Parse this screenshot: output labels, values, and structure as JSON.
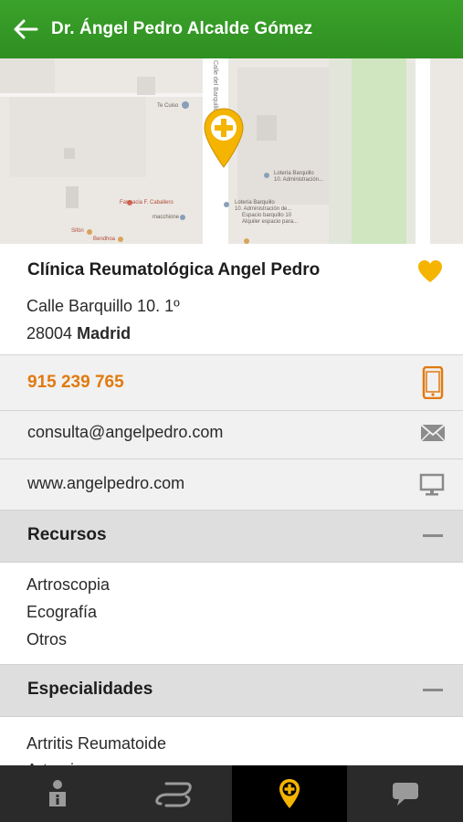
{
  "header": {
    "title": "Dr. Ángel Pedro Alcalde Gómez",
    "back_icon": "arrow-left-icon"
  },
  "map": {
    "labels": {
      "calle": "Calle del Barquillo",
      "te_cuiso": "Te Cuiso",
      "loteria1": "Lotería Barquillo",
      "loteria1b": "10. Administración...",
      "loteria2": "Lotería Barquillo",
      "loteria2b": "10. Administración de...",
      "espacio1": "Espacio barquillo 10",
      "espacio2": "Alquiler espacio para...",
      "farmacia": "Farmacia F. Caballero",
      "macchione": "macchione",
      "sifon": "Sifón",
      "bendhoa": "Bendhoa"
    },
    "pin_icon": "location-pin-plus-icon"
  },
  "clinic": {
    "name": "Clínica Reumatológica Angel Pedro",
    "address_line1": "Calle Barquillo 10. 1º",
    "postal_code": "28004",
    "city": "Madrid",
    "favorite_icon": "heart-icon",
    "favorite_color": "#f4b400"
  },
  "contact": {
    "phone": "915 239 765",
    "phone_icon": "mobile-phone-icon",
    "email": "consulta@angelpedro.com",
    "email_icon": "envelope-icon",
    "website": "www.angelpedro.com",
    "website_icon": "monitor-icon"
  },
  "sections": {
    "recursos": {
      "title": "Recursos",
      "items": [
        "Artroscopia",
        "Ecografía",
        "Otros"
      ],
      "toggle_icon": "minus-icon"
    },
    "especialidades": {
      "title": "Especialidades",
      "items": [
        "Artritis Reumatoide",
        "Artrosis"
      ],
      "toggle_icon": "minus-icon"
    }
  },
  "tabbar": {
    "tabs": [
      {
        "icon": "person-info-icon",
        "active": false
      },
      {
        "icon": "route-icon",
        "active": false
      },
      {
        "icon": "location-pin-plus-icon",
        "active": true
      },
      {
        "icon": "chat-bubble-icon",
        "active": false
      }
    ],
    "accent": "#f4b400"
  }
}
